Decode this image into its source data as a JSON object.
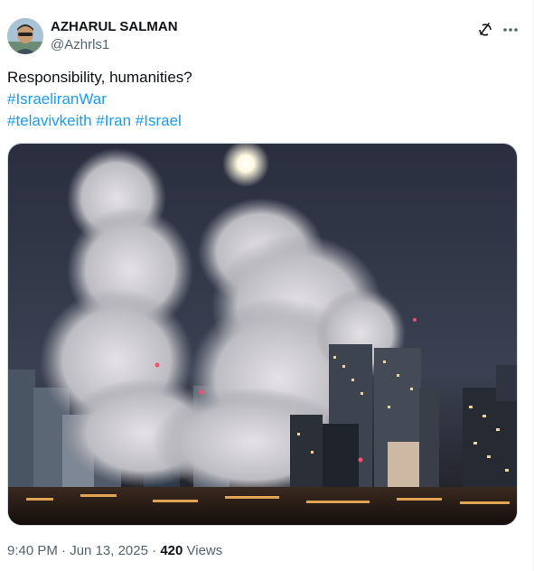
{
  "author": {
    "name": "AZHARUL SALMAN",
    "handle": "@Azhrls1"
  },
  "header_icons": [
    "grok-icon",
    "more-icon"
  ],
  "tweet": {
    "text": "Responsibility, humanities?",
    "hashtag_line_1": [
      "#IsraeliranWar"
    ],
    "hashtag_line_2": [
      "#telavivkeith",
      "#Iran",
      "#Israel"
    ]
  },
  "media": {
    "description_icon": "photo"
  },
  "meta": {
    "time": "9:40 PM",
    "separator": "·",
    "date": "Jun 13, 2025",
    "views_count": "420",
    "views_label": "Views"
  },
  "colors": {
    "link": "#1d9bf0",
    "secondary_text": "#536471",
    "primary_text": "#0f1419"
  }
}
